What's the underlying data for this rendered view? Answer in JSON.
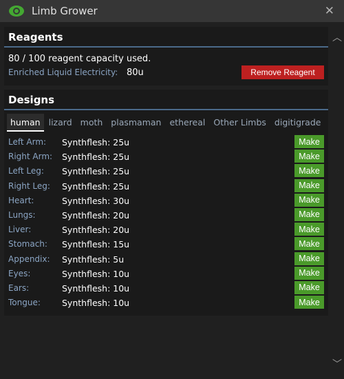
{
  "window": {
    "title": "Limb Grower",
    "icon": "eye-icon",
    "accent": "#44a832"
  },
  "reagents": {
    "title": "Reagents",
    "capacity_text": "80 / 100 reagent capacity used.",
    "items": [
      {
        "name": "Enriched Liquid Electricity:",
        "amount": "80u"
      }
    ],
    "remove_label": "Remove Reagent"
  },
  "designs": {
    "title": "Designs",
    "tabs": [
      "human",
      "lizard",
      "moth",
      "plasmaman",
      "ethereal",
      "Other Limbs",
      "digitigrade"
    ],
    "active_tab": "human",
    "make_label": "Make",
    "rows": [
      {
        "part": "Left Arm:",
        "cost": "Synthflesh: 25u"
      },
      {
        "part": "Right Arm:",
        "cost": "Synthflesh: 25u"
      },
      {
        "part": "Left Leg:",
        "cost": "Synthflesh: 25u"
      },
      {
        "part": "Right Leg:",
        "cost": "Synthflesh: 25u"
      },
      {
        "part": "Heart:",
        "cost": "Synthflesh: 30u"
      },
      {
        "part": "Lungs:",
        "cost": "Synthflesh: 20u"
      },
      {
        "part": "Liver:",
        "cost": "Synthflesh: 20u"
      },
      {
        "part": "Stomach:",
        "cost": "Synthflesh: 15u"
      },
      {
        "part": "Appendix:",
        "cost": "Synthflesh: 5u"
      },
      {
        "part": "Eyes:",
        "cost": "Synthflesh: 10u"
      },
      {
        "part": "Ears:",
        "cost": "Synthflesh: 10u"
      },
      {
        "part": "Tongue:",
        "cost": "Synthflesh: 10u"
      }
    ]
  },
  "colors": {
    "remove_button": "#bd2020",
    "make_button": "#4a9a2a",
    "section_divider": "#4b6a8a",
    "label_blue": "#8ba5c4"
  }
}
